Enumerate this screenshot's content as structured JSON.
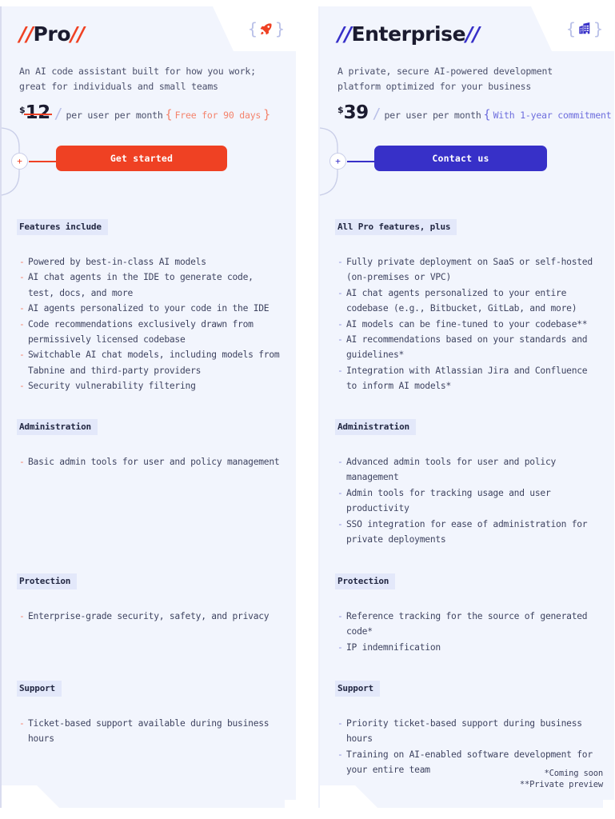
{
  "colors": {
    "pro_accent": "#ef4123",
    "enterprise_accent": "#3730c8",
    "card_bg": "#f2f5fd",
    "section_chip_bg": "#e3e8fa",
    "text": "#3e4360"
  },
  "plans": [
    {
      "id": "pro",
      "slash_left": "//",
      "name": "Pro",
      "slash_right": "//",
      "icon": "rocket-icon",
      "brace_open": "{",
      "brace_close": "}",
      "description": "An AI code assistant built for how you work; great for individuals and small teams",
      "currency": "$",
      "amount": "12",
      "amount_struck": true,
      "divider": "/",
      "period": "per user per month",
      "note": "Free for 90 days",
      "cta_label": "Get started",
      "plus_label": "+",
      "sections": [
        {
          "title": "Features include",
          "items": [
            "Powered by best-in-class AI models",
            "AI chat agents in the IDE to generate code, test, docs, and more",
            "AI agents personalized to your code in the IDE",
            "Code recommendations exclusively drawn from permissively licensed codebase",
            "Switchable AI chat models, including models from Tabnine and third-party providers",
            "Security vulnerability filtering"
          ]
        },
        {
          "title": "Administration",
          "items": [
            "Basic admin tools for user and policy management"
          ]
        },
        {
          "title": "Protection",
          "items": [
            "Enterprise-grade security, safety, and privacy"
          ]
        },
        {
          "title": "Support",
          "items": [
            "Ticket-based support available during business hours"
          ]
        }
      ]
    },
    {
      "id": "enterprise",
      "slash_left": "//",
      "name": "Enterprise",
      "slash_right": "//",
      "icon": "building-icon",
      "brace_open": "{",
      "brace_close": "}",
      "description": "A private, secure AI-powered development platform optimized for your business",
      "currency": "$",
      "amount": "39",
      "amount_struck": false,
      "divider": "/",
      "period": "per user per month",
      "note": "With 1-year commitment",
      "cta_label": "Contact us",
      "plus_label": "+",
      "sections": [
        {
          "title": "All Pro features, plus",
          "items": [
            "Fully private deployment on SaaS or self-hosted (on-premises or VPC)",
            "AI chat agents personalized to your entire codebase (e.g., Bitbucket, GitLab, and more)",
            "AI models can be fine-tuned to your codebase**",
            "AI recommendations based on your standards and guidelines*",
            "Integration with Atlassian Jira and Confluence to inform AI models*"
          ]
        },
        {
          "title": "Administration",
          "items": [
            "Advanced admin tools for user and policy management",
            "Admin tools for tracking usage and user productivity",
            "SSO integration for ease of administration for private deployments"
          ]
        },
        {
          "title": "Protection",
          "items": [
            "Reference tracking for the source of generated code*",
            "IP indemnification"
          ]
        },
        {
          "title": "Support",
          "items": [
            "Priority ticket-based support during business hours",
            "Training on AI-enabled software development for your entire team"
          ]
        }
      ]
    }
  ],
  "footnotes": {
    "line1": "*Coming soon",
    "line2": "**Private preview"
  },
  "section_tops": [
    264,
    514,
    707,
    841
  ]
}
